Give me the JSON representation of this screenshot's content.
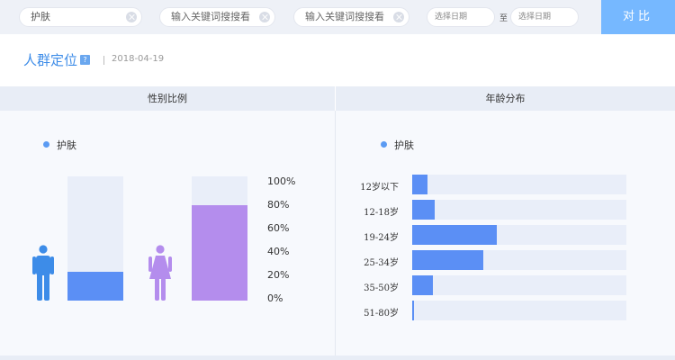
{
  "topbar": {
    "search1": {
      "value": "护肤"
    },
    "search2": {
      "placeholder": "输入关键词搜搜看"
    },
    "search3": {
      "placeholder": "输入关键词搜搜看"
    },
    "date_start_placeholder": "选择日期",
    "date_to": "至",
    "date_end_placeholder": "选择日期",
    "compare_label": "对比"
  },
  "header": {
    "title": "人群定位",
    "help": "?",
    "date": "2018-04-19"
  },
  "gender_panel": {
    "title": "性别比例",
    "legend": "护肤",
    "male_share": 0.23,
    "female_share": 0.77,
    "male_color": "#5b8ff5",
    "female_color": "#b48ded",
    "axis_ticks": [
      "100%",
      "80%",
      "60%",
      "40%",
      "20%",
      "0%"
    ]
  },
  "age_panel": {
    "title": "年龄分布",
    "legend": "护肤",
    "groups": [
      {
        "label": "12岁以下",
        "share": 0.07
      },
      {
        "label": "12-18岁",
        "share": 0.105
      },
      {
        "label": "19-24岁",
        "share": 0.395
      },
      {
        "label": "25-34岁",
        "share": 0.33
      },
      {
        "label": "35-50岁",
        "share": 0.095
      },
      {
        "label": "51-80岁",
        "share": 0.01
      }
    ]
  },
  "colors": {
    "accent": "#3d8ce8",
    "bar_blue": "#5b8ff5",
    "bar_purple": "#b48ded",
    "track": "#e9eef9",
    "button": "#76b8ff"
  }
}
